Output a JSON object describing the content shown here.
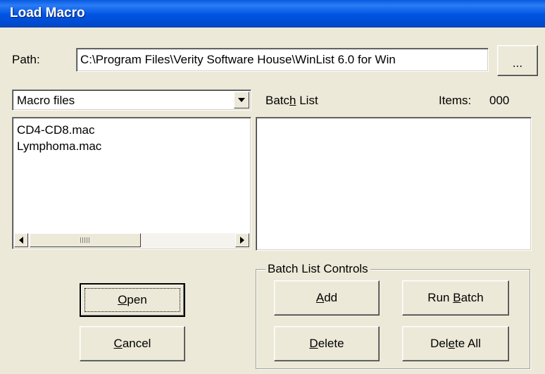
{
  "window": {
    "title": "Load Macro"
  },
  "path": {
    "label": "Path:",
    "value": "C:\\Program Files\\Verity Software House\\WinList 6.0 for Win",
    "browse_label": "..."
  },
  "file_type": {
    "selected": "Macro files"
  },
  "macro_files": [
    "CD4-CD8.mac",
    "Lymphoma.mac"
  ],
  "batch": {
    "label_pre": "Batc",
    "label_key": "h",
    "label_post": " List",
    "items_label": "Items:",
    "items_count": "000",
    "items": []
  },
  "controls": {
    "group_label": "Batch List Controls",
    "add_key": "A",
    "add_rest": "dd",
    "run_pre": "Run ",
    "run_key": "B",
    "run_rest": "atch",
    "delete_key": "D",
    "delete_rest": "elete",
    "delall_pre": "Del",
    "delall_key": "e",
    "delall_rest": "te All"
  },
  "actions": {
    "open_key": "O",
    "open_rest": "pen",
    "cancel_key": "C",
    "cancel_rest": "ancel"
  }
}
